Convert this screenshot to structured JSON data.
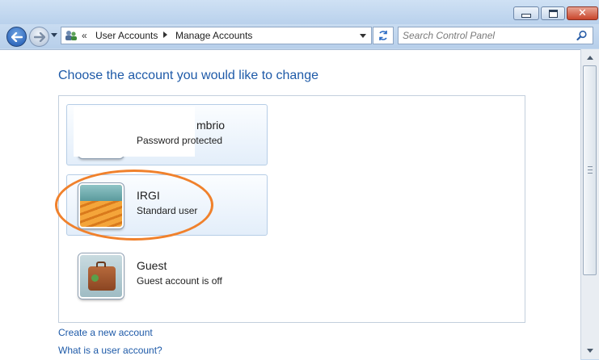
{
  "window": {
    "controls": {
      "minimize_icon": "minimize-icon",
      "maximize_icon": "maximize-icon",
      "close_glyph": "✕"
    }
  },
  "nav": {
    "breadcrumb_chevron": "«",
    "breadcrumb": [
      "User Accounts",
      "Manage Accounts"
    ],
    "search_placeholder": "Search Control Panel"
  },
  "main": {
    "heading": "Choose the account you would like to change",
    "accounts": [
      {
        "name": "mbrio",
        "status": "Password protected",
        "avatar": "chess-pieces-avatar"
      },
      {
        "name": "IRGI",
        "status": "Standard user",
        "avatar": "stairs-avatar"
      },
      {
        "name": "Guest",
        "status": "Guest account is off",
        "avatar": "suitcase-avatar"
      }
    ],
    "links": {
      "create": "Create a new account",
      "what": "What is a user account?"
    },
    "annotation_color": "#f0812c"
  }
}
